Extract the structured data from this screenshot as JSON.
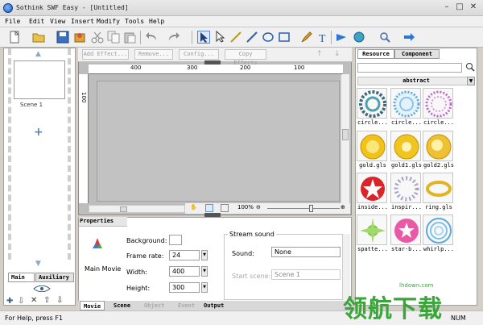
{
  "window": {
    "title": "Sothink SWF Easy - [Untitled]"
  },
  "menu": {
    "items": [
      "File",
      "Edit",
      "View",
      "Insert",
      "Modify",
      "Tools",
      "Help"
    ]
  },
  "effects": {
    "add": "Add Effect...",
    "remove": "Remove...",
    "config": "Config...",
    "copy": "Copy Effects"
  },
  "ruler": {
    "labels": [
      "400",
      "300",
      "200",
      "100"
    ],
    "v_label": "100"
  },
  "scene": {
    "label": "Scene 1"
  },
  "left_tabs": {
    "main": "Main",
    "aux": "Auxiliary"
  },
  "zoom": {
    "value": "100%"
  },
  "right_panel": {
    "tabs": {
      "resource": "Resource",
      "component": "Component"
    },
    "category": "abstract",
    "items": [
      {
        "label": "circle..."
      },
      {
        "label": "circle..."
      },
      {
        "label": "circle..."
      },
      {
        "label": "gold.gls"
      },
      {
        "label": "gold1.gls"
      },
      {
        "label": "gold2.gls"
      },
      {
        "label": "inside..."
      },
      {
        "label": "inspir..."
      },
      {
        "label": "ring.gls"
      },
      {
        "label": "spatte..."
      },
      {
        "label": "star-b..."
      },
      {
        "label": "whirlp..."
      }
    ]
  },
  "properties": {
    "title": "Properties",
    "main_movie": "Main Movie",
    "background_label": "Background:",
    "framerate_label": "Frame rate:",
    "framerate": "24",
    "width_label": "Width:",
    "width": "400",
    "height_label": "Height:",
    "height": "300",
    "stream_title": "Stream sound",
    "sound_label": "Sound:",
    "sound_value": "None",
    "startscene_label": "Start scene:",
    "startscene_value": "Scene 1"
  },
  "bottom_tabs": {
    "movie": "Movie",
    "scene": "Scene",
    "object": "Object",
    "event": "Event",
    "output": "Output"
  },
  "status": {
    "text": "For Help, press F1",
    "num": "NUM"
  },
  "watermark": {
    "text": "领航下载",
    "site": "lhdown.com"
  },
  "colors": {
    "accent": "#2e5fa8",
    "watermark_green": "#3aa63a"
  }
}
